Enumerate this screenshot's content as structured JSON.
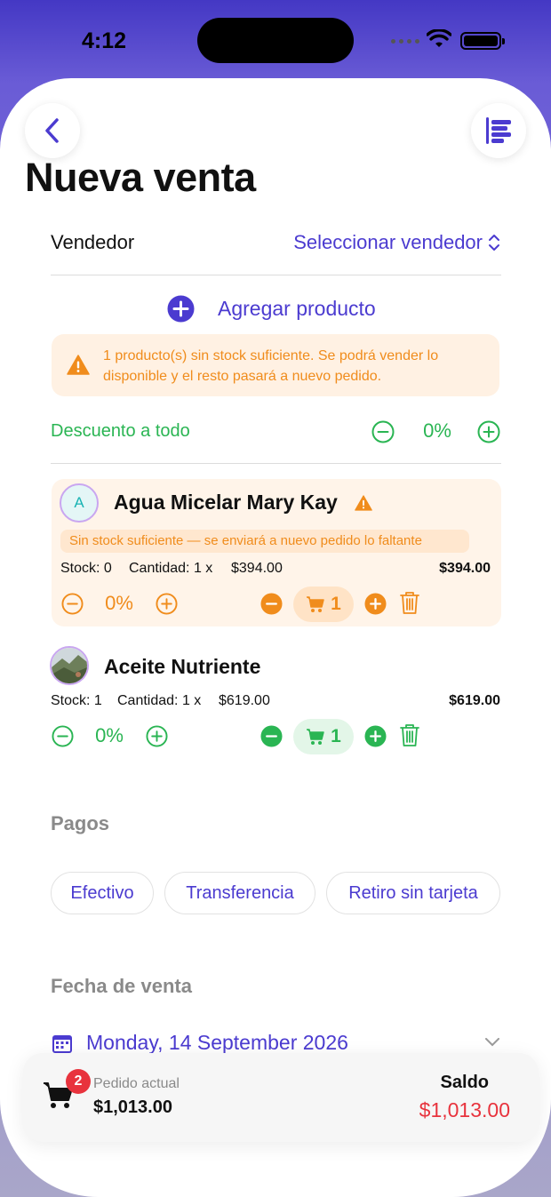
{
  "status": {
    "time": "4:12"
  },
  "header": {
    "title": "Nueva venta",
    "back_icon": "chevron-left-icon",
    "menu_icon": "list-icon"
  },
  "seller": {
    "label": "Vendedor",
    "value": "Seleccionar vendedor"
  },
  "add_product": {
    "label": "Agregar producto"
  },
  "stock_warning": {
    "text": "1 producto(s) sin stock suficiente. Se podrá vender lo disponible y el resto pasará a nuevo pedido."
  },
  "global_discount": {
    "label": "Descuento a todo",
    "value": "0%"
  },
  "products": [
    {
      "initial": "A",
      "name": "Agua Micelar Mary Kay",
      "warning": "Sin stock suficiente — se enviará a nuevo pedido lo faltante",
      "stock_label": "Stock: 0",
      "quantity_text": "Cantidad: 1 x",
      "unit_price": "$394.00",
      "total": "$394.00",
      "discount": "0%",
      "qty": "1",
      "accent": "#f08c1c"
    },
    {
      "name": "Aceite Nutriente",
      "stock_label": "Stock: 1",
      "quantity_text": "Cantidad: 1 x",
      "unit_price": "$619.00",
      "total": "$619.00",
      "discount": "0%",
      "qty": "1",
      "accent": "#2ab553"
    }
  ],
  "payments": {
    "heading": "Pagos",
    "options": [
      "Efectivo",
      "Transferencia",
      "Retiro sin tarjeta"
    ]
  },
  "sale_date": {
    "heading": "Fecha de venta",
    "value": "Monday, 14 September 2026"
  },
  "summary": {
    "cart_count": "2",
    "order_label": "Pedido actual",
    "order_total": "$1,013.00",
    "balance_label": "Saldo",
    "balance_value": "$1,013.00"
  },
  "colors": {
    "accent": "#4b3bd0",
    "success": "#2ab553",
    "warning": "#f08c1c",
    "danger": "#e8333d"
  }
}
